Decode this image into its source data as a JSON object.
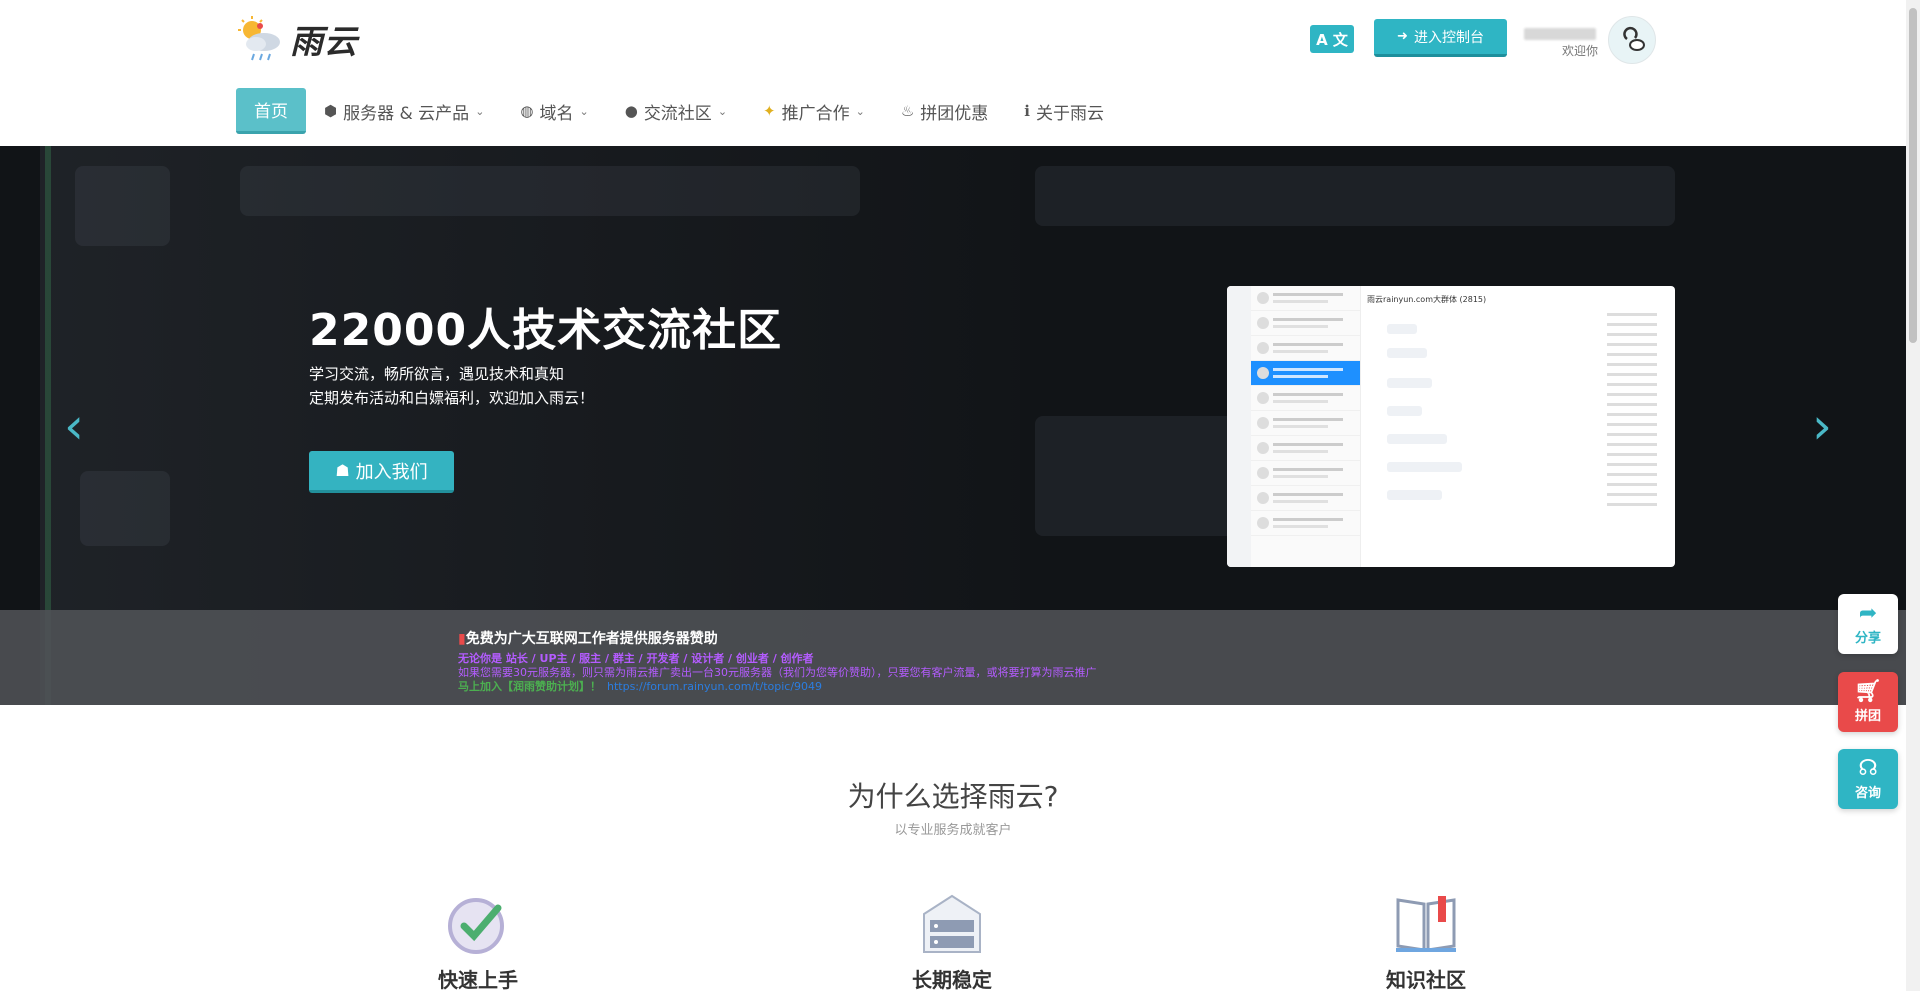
{
  "brand": {
    "name": "雨云",
    "logo_icon": "sun-cloud-rain-icon"
  },
  "header": {
    "lang_label": "A 文",
    "console_label": "进入控制台",
    "welcome": "欢迎你"
  },
  "nav": {
    "items": [
      {
        "label": "首页",
        "icon": "",
        "dropdown": false
      },
      {
        "label": "服务器 & 云产品",
        "icon": "cubes-icon",
        "dropdown": true
      },
      {
        "label": "域名",
        "icon": "globe-icon",
        "dropdown": true
      },
      {
        "label": "交流社区",
        "icon": "chat-icon",
        "dropdown": true
      },
      {
        "label": "推广合作",
        "icon": "sparkle-icon",
        "dropdown": true
      },
      {
        "label": "拼团优惠",
        "icon": "flame-icon",
        "dropdown": false
      },
      {
        "label": "关于雨云",
        "icon": "info-icon",
        "dropdown": false
      }
    ]
  },
  "hero": {
    "title": "22000人技术交流社区",
    "sub1": "学习交流，畅所欲言，遇见技术和真知",
    "sub2": "定期发布活动和白嫖福利，欢迎加入雨云！",
    "join_label": "加入我们",
    "shot_title": "雨云rainyun.com大群体 (2815)"
  },
  "notice": {
    "title": "免费为广大互联网工作者提供服务器赞助",
    "line1": "无论你是 站长 / UP主 / 服主 / 群主 / 开发者 / 设计者 / 创业者 / 创作者",
    "line2": "如果您需要30元服务器，则只需为雨云推广卖出一台30元服务器（我们为您等价赞助），只要您有客户流量，或将要打算为雨云推广",
    "line3": "马上加入【润雨赞助计划】！",
    "link": "https://forum.rainyun.com/t/topic/9049"
  },
  "why": {
    "title": "为什么选择雨云?",
    "subtitle": "以专业服务成就客户",
    "features": [
      {
        "label": "快速上手",
        "icon": "check-circle-icon"
      },
      {
        "label": "长期稳定",
        "icon": "server-icon"
      },
      {
        "label": "知识社区",
        "icon": "book-icon"
      }
    ]
  },
  "float": {
    "share": "分享",
    "group": "拼团",
    "consult": "咨询"
  },
  "colors": {
    "accent": "#2fb5c4",
    "danger": "#e94a4a",
    "purple": "#b45cff"
  }
}
